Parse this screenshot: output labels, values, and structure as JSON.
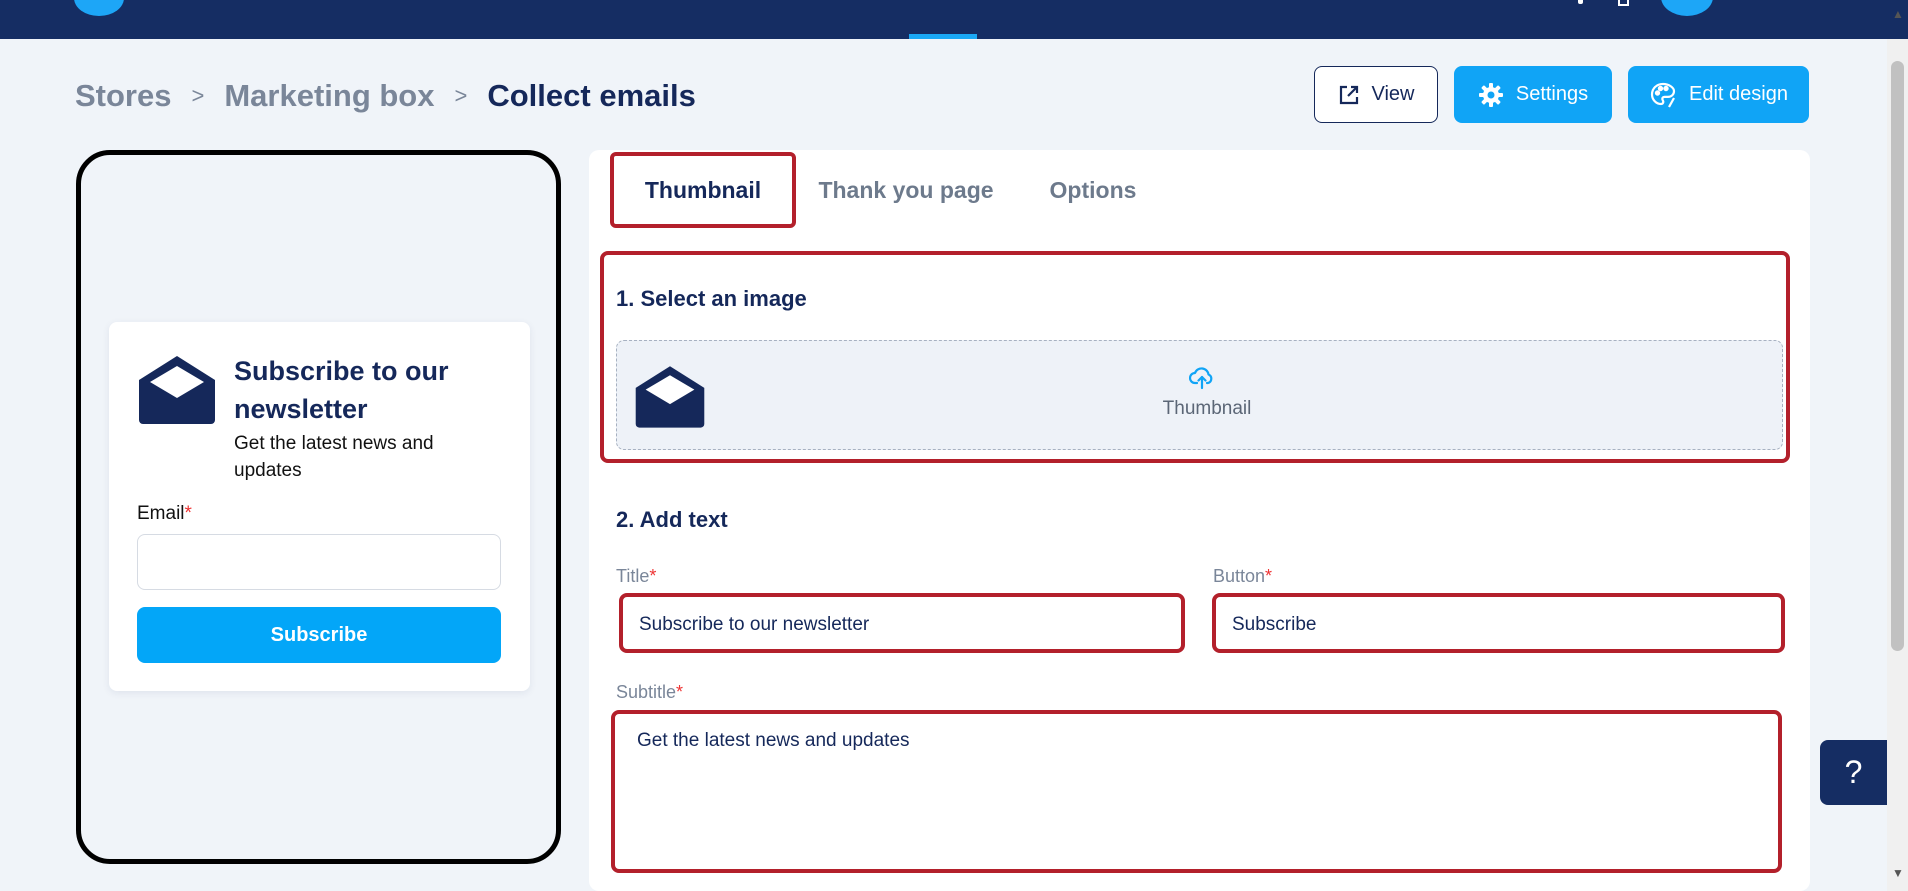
{
  "breadcrumb": {
    "items": [
      "Stores",
      "Marketing box",
      "Collect emails"
    ],
    "separator": ">"
  },
  "header_actions": {
    "view_label": "View",
    "settings_label": "Settings",
    "edit_design_label": "Edit design"
  },
  "preview": {
    "title": "Subscribe to our newsletter",
    "subtitle": "Get the latest news and updates",
    "email_label": "Email",
    "required_marker": "*",
    "button_label": "Subscribe"
  },
  "tabs": [
    {
      "label": "Thumbnail",
      "active": true
    },
    {
      "label": "Thank you page",
      "active": false
    },
    {
      "label": "Options",
      "active": false
    }
  ],
  "form": {
    "section1_title": "1. Select an image",
    "upload_label": "Thumbnail",
    "section2_title": "2. Add text",
    "title_label": "Title",
    "title_value": "Subscribe to our newsletter",
    "button_label": "Button",
    "button_value": "Subscribe",
    "subtitle_label": "Subtitle",
    "subtitle_value": "Get the latest news and updates",
    "required_marker": "*"
  },
  "help_button": {
    "label": "?"
  },
  "colors": {
    "navy": "#152d63",
    "accent": "#10a4f6",
    "highlight": "#b3202b",
    "required": "#e33333"
  },
  "icons": [
    "external-link-icon",
    "gear-icon",
    "palette-icon",
    "envelope-open-icon",
    "cloud-upload-icon",
    "help-icon"
  ]
}
